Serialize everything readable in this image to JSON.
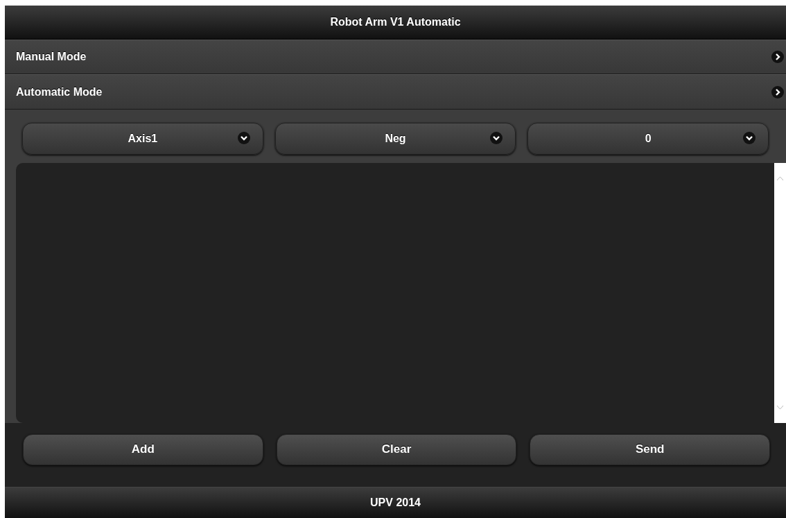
{
  "header": {
    "title": "Robot Arm V1 Automatic"
  },
  "sections": [
    {
      "label": "Manual Mode",
      "expanded": false
    },
    {
      "label": "Automatic Mode",
      "expanded": false
    }
  ],
  "selects": [
    {
      "value": "Axis1"
    },
    {
      "value": "Neg"
    },
    {
      "value": "0"
    }
  ],
  "buttons": [
    "Add",
    "Clear",
    "Send"
  ],
  "footer": {
    "text": "UPV 2014"
  }
}
